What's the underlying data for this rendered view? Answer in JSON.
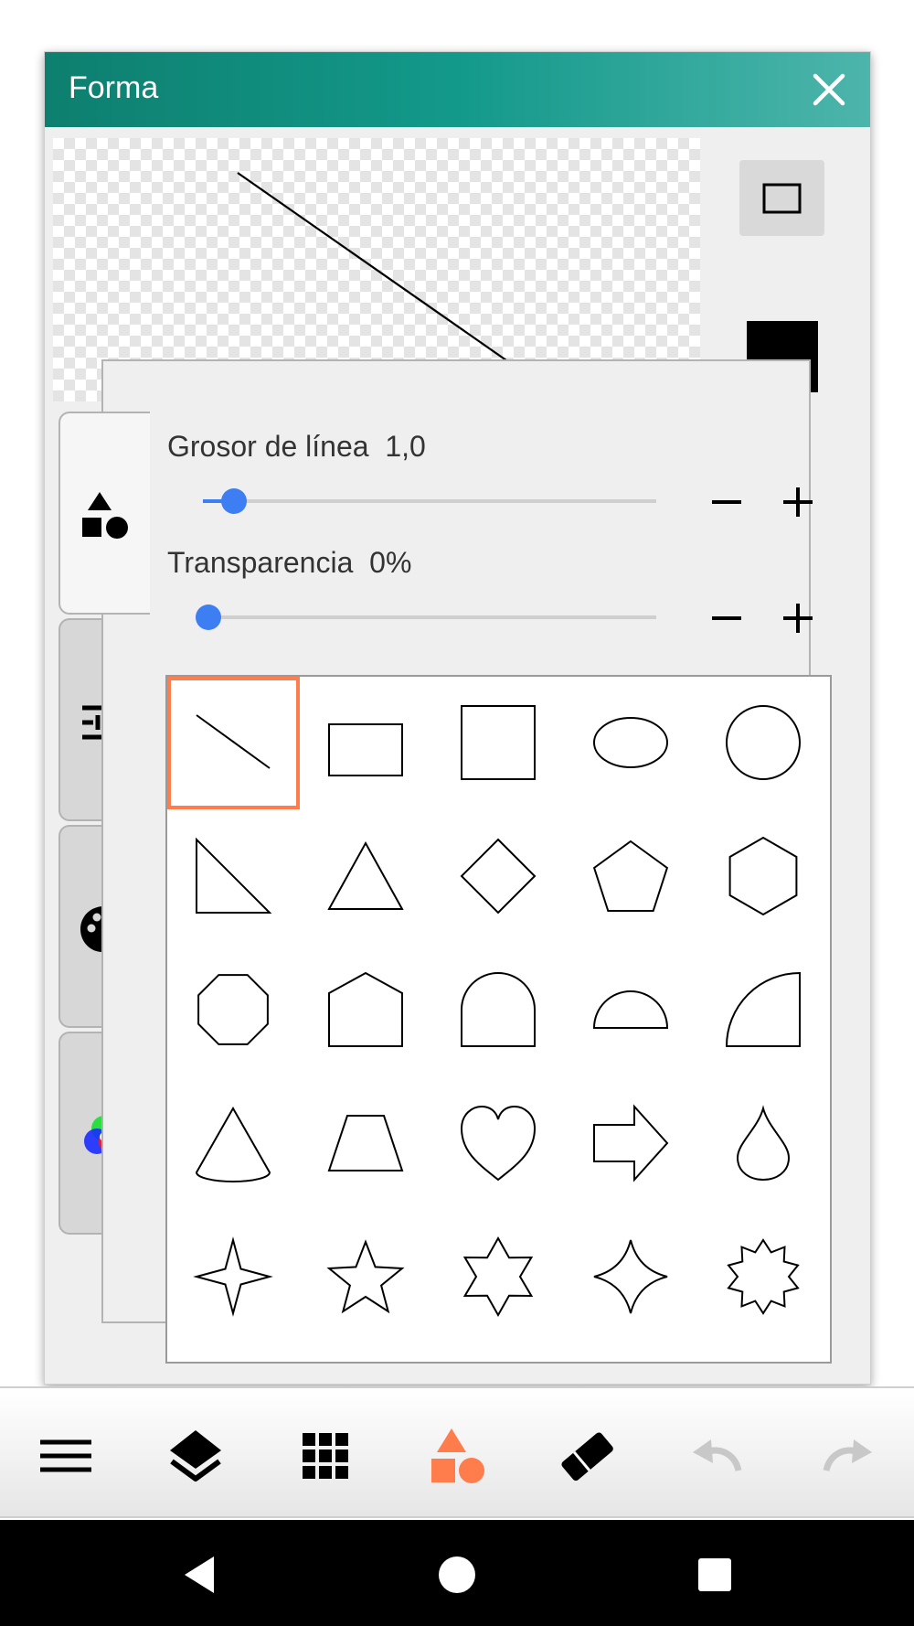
{
  "dialog": {
    "title": "Forma",
    "close_icon": "close-icon",
    "shape_mode_icon": "rectangle-outline-icon",
    "current_color": "#000000"
  },
  "side_tabs": [
    {
      "icon": "shapes-icon",
      "active": true
    },
    {
      "icon": "sliders-icon",
      "active": false
    },
    {
      "icon": "palette-icon",
      "active": false
    },
    {
      "icon": "rgb-circles-icon",
      "active": false
    }
  ],
  "settings": {
    "line_width_label": "Grosor de línea",
    "line_width_value": "1,0",
    "line_width_fraction": 0.04,
    "transparency_label": "Transparencia",
    "transparency_value": "0%",
    "transparency_fraction": 0.0,
    "minus_label": "−",
    "plus_label": "+"
  },
  "shapes": [
    "line",
    "rectangle",
    "square",
    "ellipse",
    "circle",
    "right-triangle",
    "triangle",
    "diamond",
    "pentagon",
    "hexagon",
    "octagon",
    "house-pentagon",
    "arch",
    "semicircle",
    "quarter-circle",
    "cone",
    "trapezoid",
    "heart",
    "arrow-right",
    "drop",
    "star-4",
    "star-5",
    "star-6",
    "star-4-curved",
    "star-burst"
  ],
  "selected_shape": "line",
  "accent_color": "#ff7d4d",
  "slider_color": "#3d7ff3",
  "title_bar_color": "#13998a",
  "toolbar": [
    {
      "icon": "menu-icon",
      "active": false,
      "enabled": true
    },
    {
      "icon": "layers-icon",
      "active": false,
      "enabled": true
    },
    {
      "icon": "grid-icon",
      "active": false,
      "enabled": true
    },
    {
      "icon": "shapes-icon",
      "active": true,
      "enabled": true
    },
    {
      "icon": "eraser-icon",
      "active": false,
      "enabled": true
    },
    {
      "icon": "undo-icon",
      "active": false,
      "enabled": false
    },
    {
      "icon": "redo-icon",
      "active": false,
      "enabled": false
    }
  ],
  "navbar": [
    "back-icon",
    "home-icon",
    "recents-icon"
  ]
}
